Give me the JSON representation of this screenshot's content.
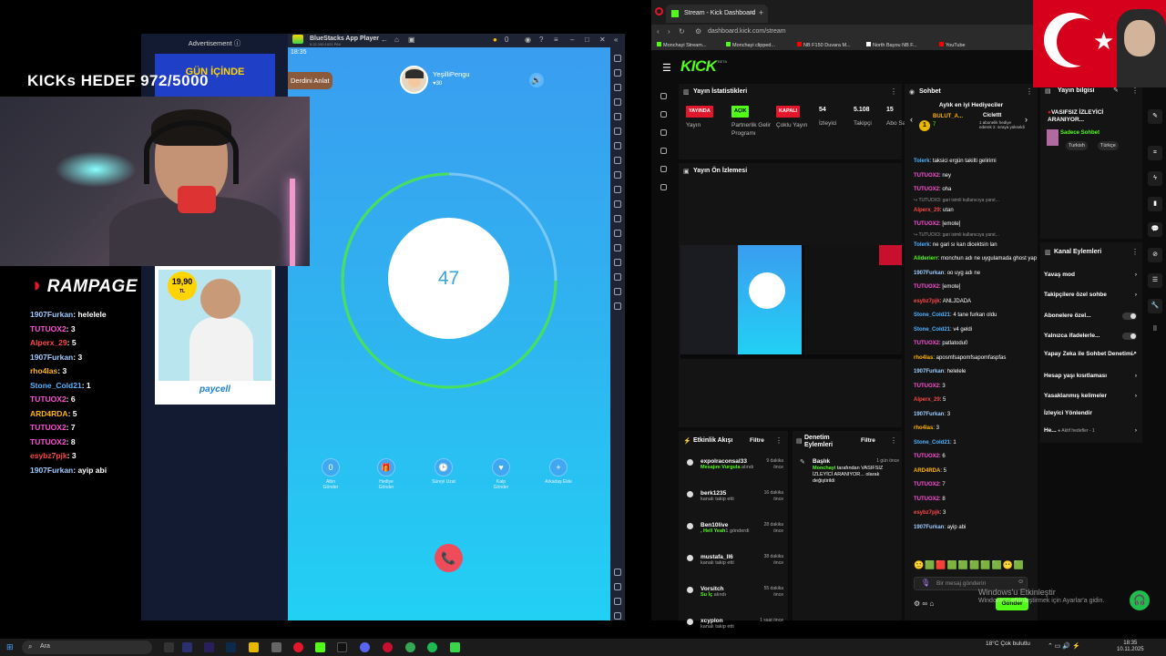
{
  "overlay": {
    "title": "KICKs HEDEF 972/5000",
    "sponsor_logo": "RAMPAGE",
    "chat": [
      {
        "user": "1907Furkan",
        "text": "helelele",
        "color": "#9ecbff"
      },
      {
        "user": "TUTUOX2",
        "text": "3",
        "color": "#ff4fd8"
      },
      {
        "user": "Alperx_29",
        "text": "5",
        "color": "#ff4545"
      },
      {
        "user": "1907Furkan",
        "text": "3",
        "color": "#9ecbff"
      },
      {
        "user": "rho4las",
        "text": "3",
        "color": "#ffb300"
      },
      {
        "user": "Stone_Cold21",
        "text": "1",
        "color": "#4fb3ff"
      },
      {
        "user": "TUTUOX2",
        "text": "6",
        "color": "#ff4fd8"
      },
      {
        "user": "ARD4RDA",
        "text": "5",
        "color": "#ffb300"
      },
      {
        "user": "TUTUOX2",
        "text": "7",
        "color": "#ff4fd8"
      },
      {
        "user": "TUTUOX2",
        "text": "8",
        "color": "#ff4fd8"
      },
      {
        "user": "esybz7pjk",
        "text": "3",
        "color": "#ff4545"
      },
      {
        "user": "1907Furkan",
        "text": "ayip abi",
        "color": "#9ecbff"
      }
    ]
  },
  "ad": {
    "label": "Advertisement ⓘ",
    "price": "19,90",
    "currency": "TL",
    "brand": "paycell",
    "banner_text": "GÜN İÇİNDE"
  },
  "bluestacks": {
    "title": "BlueStacks App Player",
    "subtitle": "5.22.100.1021 P64",
    "coins": "0",
    "time": "18:35",
    "derdini_button": "Derdini Anlat",
    "username": "YeşilliPengu",
    "hearts": "♥30",
    "timer": "47",
    "actions": [
      {
        "icon": "0",
        "label": "Altın\nGönder"
      },
      {
        "icon": "🎁",
        "label": "Hediye\nGönder"
      },
      {
        "icon": "🕒",
        "label": "Süreyi Uzat"
      },
      {
        "icon": "♥",
        "label": "Kalp\nGönder"
      },
      {
        "icon": "+",
        "label": "Arkadaş Ekle"
      }
    ]
  },
  "browser": {
    "tab_title": "Stream - Kick Dashboard",
    "url": "dashboard.kick.com/stream",
    "bookmarks": [
      {
        "label": "Monchayi Stream...",
        "color": "#53fc18"
      },
      {
        "label": "Monchayi clipped...",
        "color": "#53fc18"
      },
      {
        "label": "NB F150 Duvara M...",
        "color": "#ff0000"
      },
      {
        "label": "North Bayou NB F...",
        "color": "#ffffff"
      },
      {
        "label": "YouTube",
        "color": "#ff0000"
      }
    ],
    "logo": "KICK",
    "logo_beta": "BETA"
  },
  "stats": {
    "title": "Yayın İstatistikleri",
    "items": [
      {
        "badge": "YAYINDA",
        "badge_color": "#e3172b",
        "label": "Yayın"
      },
      {
        "badge": "AÇIK",
        "badge_color": "#53fc18",
        "label": "Partnerlik Gelir Programı"
      },
      {
        "badge": "KAPALI",
        "badge_color": "#e3172b",
        "label": "Çoklu Yayın"
      },
      {
        "num": "54",
        "label": "İzleyici"
      },
      {
        "num": "5.108",
        "label": "Takipçi"
      },
      {
        "num": "15",
        "label": "Abo Say"
      }
    ]
  },
  "preview": {
    "title": "Yayın Ön İzlemesi"
  },
  "activity": {
    "title": "Etkinlik Akışı",
    "filter": "Filtre",
    "events": [
      {
        "user": "expolraconsal33",
        "detail": "Mesajını Vurgula",
        "suffix": " alındı",
        "time": "9 dakika önce"
      },
      {
        "user": "berk1235",
        "detail": "",
        "suffix": "kanalı takip etti",
        "time": "16 dakika önce"
      },
      {
        "user": "Ben10live",
        "detail": ", Hell Yeah",
        "suffix": "1 gönderdi",
        "time": "28 dakika önce"
      },
      {
        "user": "mustafa_ll6",
        "detail": "",
        "suffix": "kanalı takip etti",
        "time": "38 dakika önce"
      },
      {
        "user": "Vorsitch",
        "detail": "Su İç",
        "suffix": " alındı",
        "time": "55 dakika önce"
      },
      {
        "user": "xcyplon",
        "detail": "",
        "suffix": "kanalı takip etti",
        "time": "1 saat önce"
      }
    ]
  },
  "moderation": {
    "title": "Denetim Eylemleri",
    "filter": "Filtre",
    "entry_title": "Başlık",
    "entry_time": "1 gün önce",
    "entry_by": "Monchayi",
    "entry_text": "tarafından VASIFSIZ İZLEYİCİ ARANIYOR... olarak değiştirildi"
  },
  "chat": {
    "title": "Sohbet",
    "gifters_title": "Aylık en iyi Hediyeciler",
    "gifter_name": "BULUT_A...",
    "gifter_count": "7",
    "gifter2_name": "Ciclettt",
    "gifter2_note": "1 abonelik hediye ederek 2. sıraya yükseldi",
    "messages": [
      {
        "user": "Tolerk",
        "text": "taksici ergün takilti gelirimi",
        "color": "#4fb3ff"
      },
      {
        "user": "TUTUOX2",
        "text": "ney",
        "color": "#ff4fd8"
      },
      {
        "user": "TUTUOX2",
        "text": "oha",
        "color": "#ff4fd8"
      },
      {
        "user": "",
        "text": "↪ TUTUOX3: gari isimli kullanıcıya yanıt...",
        "color": "#999",
        "small": true
      },
      {
        "user": "Alperx_29",
        "text": "utan",
        "color": "#ff4545"
      },
      {
        "user": "TUTUOX2",
        "text": "[emote]",
        "color": "#ff4fd8"
      },
      {
        "user": "",
        "text": "↪ TUTUOX3: gari isimli kullanıcıya yanıt...",
        "color": "#999",
        "small": true
      },
      {
        "user": "Tolerk",
        "text": "ne gari sı kan dicektsin lan",
        "color": "#4fb3ff"
      },
      {
        "user": "Aliderierr",
        "text": "monchun adı ne uygulamada ghost yapıyom",
        "color": "#53fc18"
      },
      {
        "user": "1907Furkan",
        "text": "oo uyg adı ne",
        "color": "#9ecbff"
      },
      {
        "user": "TUTUOX2",
        "text": "[emote]",
        "color": "#ff4fd8"
      },
      {
        "user": "esybz7pjk",
        "text": "ANLJDADA",
        "color": "#ff4545"
      },
      {
        "user": "Stone_Cold21",
        "text": "4 tane furkan oldu",
        "color": "#4fb3ff"
      },
      {
        "user": "Stone_Cold21",
        "text": "v4 geldi",
        "color": "#4fb3ff"
      },
      {
        "user": "TUTUOX2",
        "text": "patlatodu0",
        "color": "#ff4fd8"
      },
      {
        "user": "rho4las",
        "text": "aposmfsapomfsapomfaspfas",
        "color": "#ffb300"
      },
      {
        "user": "1907Furkan",
        "text": "helelele",
        "color": "#9ecbff"
      },
      {
        "user": "TUTUOX2",
        "text": "3",
        "color": "#ff4fd8"
      },
      {
        "user": "Alperx_29",
        "text": "5",
        "color": "#ff4545"
      },
      {
        "user": "1907Furkan",
        "text": "3",
        "color": "#9ecbff"
      },
      {
        "user": "rho4las",
        "text": "3",
        "color": "#ffb300"
      },
      {
        "user": "Stone_Cold21",
        "text": "1",
        "color": "#4fb3ff"
      },
      {
        "user": "TUTUOX2",
        "text": "6",
        "color": "#ff4fd8"
      },
      {
        "user": "ARD4RDA",
        "text": "5",
        "color": "#ffb300"
      },
      {
        "user": "TUTUOX2",
        "text": "7",
        "color": "#ff4fd8"
      },
      {
        "user": "TUTUOX2",
        "text": "8",
        "color": "#ff4fd8"
      },
      {
        "user": "esybz7pjk",
        "text": "3",
        "color": "#ff4545"
      },
      {
        "user": "1907Furkan",
        "text": "ayip abi",
        "color": "#9ecbff"
      }
    ],
    "input_placeholder": "Bir mesaj gönderin",
    "send_label": "Gönder"
  },
  "info": {
    "title": "Yayın bilgisi",
    "stream_title": "VASIFSIZ İZLEYİCİ ARANIYOR...",
    "category": "Sadece Sohbet",
    "tags": [
      "Turkish",
      "Türkçe"
    ]
  },
  "actions": {
    "title": "Kanal Eylemleri",
    "rows": [
      {
        "label": "Yavaş mod",
        "kind": "chevron"
      },
      {
        "label": "Takipçilere özel sohbe",
        "kind": "chevron"
      },
      {
        "label": "Abonelere özel...",
        "kind": "toggle"
      },
      {
        "label": "Yalnızca ifadelerle...",
        "kind": "toggle"
      },
      {
        "label": "Yapay Zeka ile Sohbet Denetimi",
        "kind": "link"
      },
      {
        "label": "Hesap yaşı kısıtlaması",
        "kind": "chevron"
      },
      {
        "label": "Yasaklanmış kelimeler",
        "kind": "chevron"
      },
      {
        "label": "İzleyici Yönlendir",
        "kind": "none"
      },
      {
        "label": "He...",
        "kind": "goal",
        "extra": "● Aktif hedefler - 1"
      }
    ]
  },
  "windows": {
    "activate_title": "Windows'u Etkinleştir",
    "activate_sub": "Windows'u etkinleştirmek için Ayarlar'a gidin.",
    "search": "Ara",
    "weather": "18°C Çok bulutlu",
    "time": "18:35",
    "date": "10.11.2025"
  }
}
